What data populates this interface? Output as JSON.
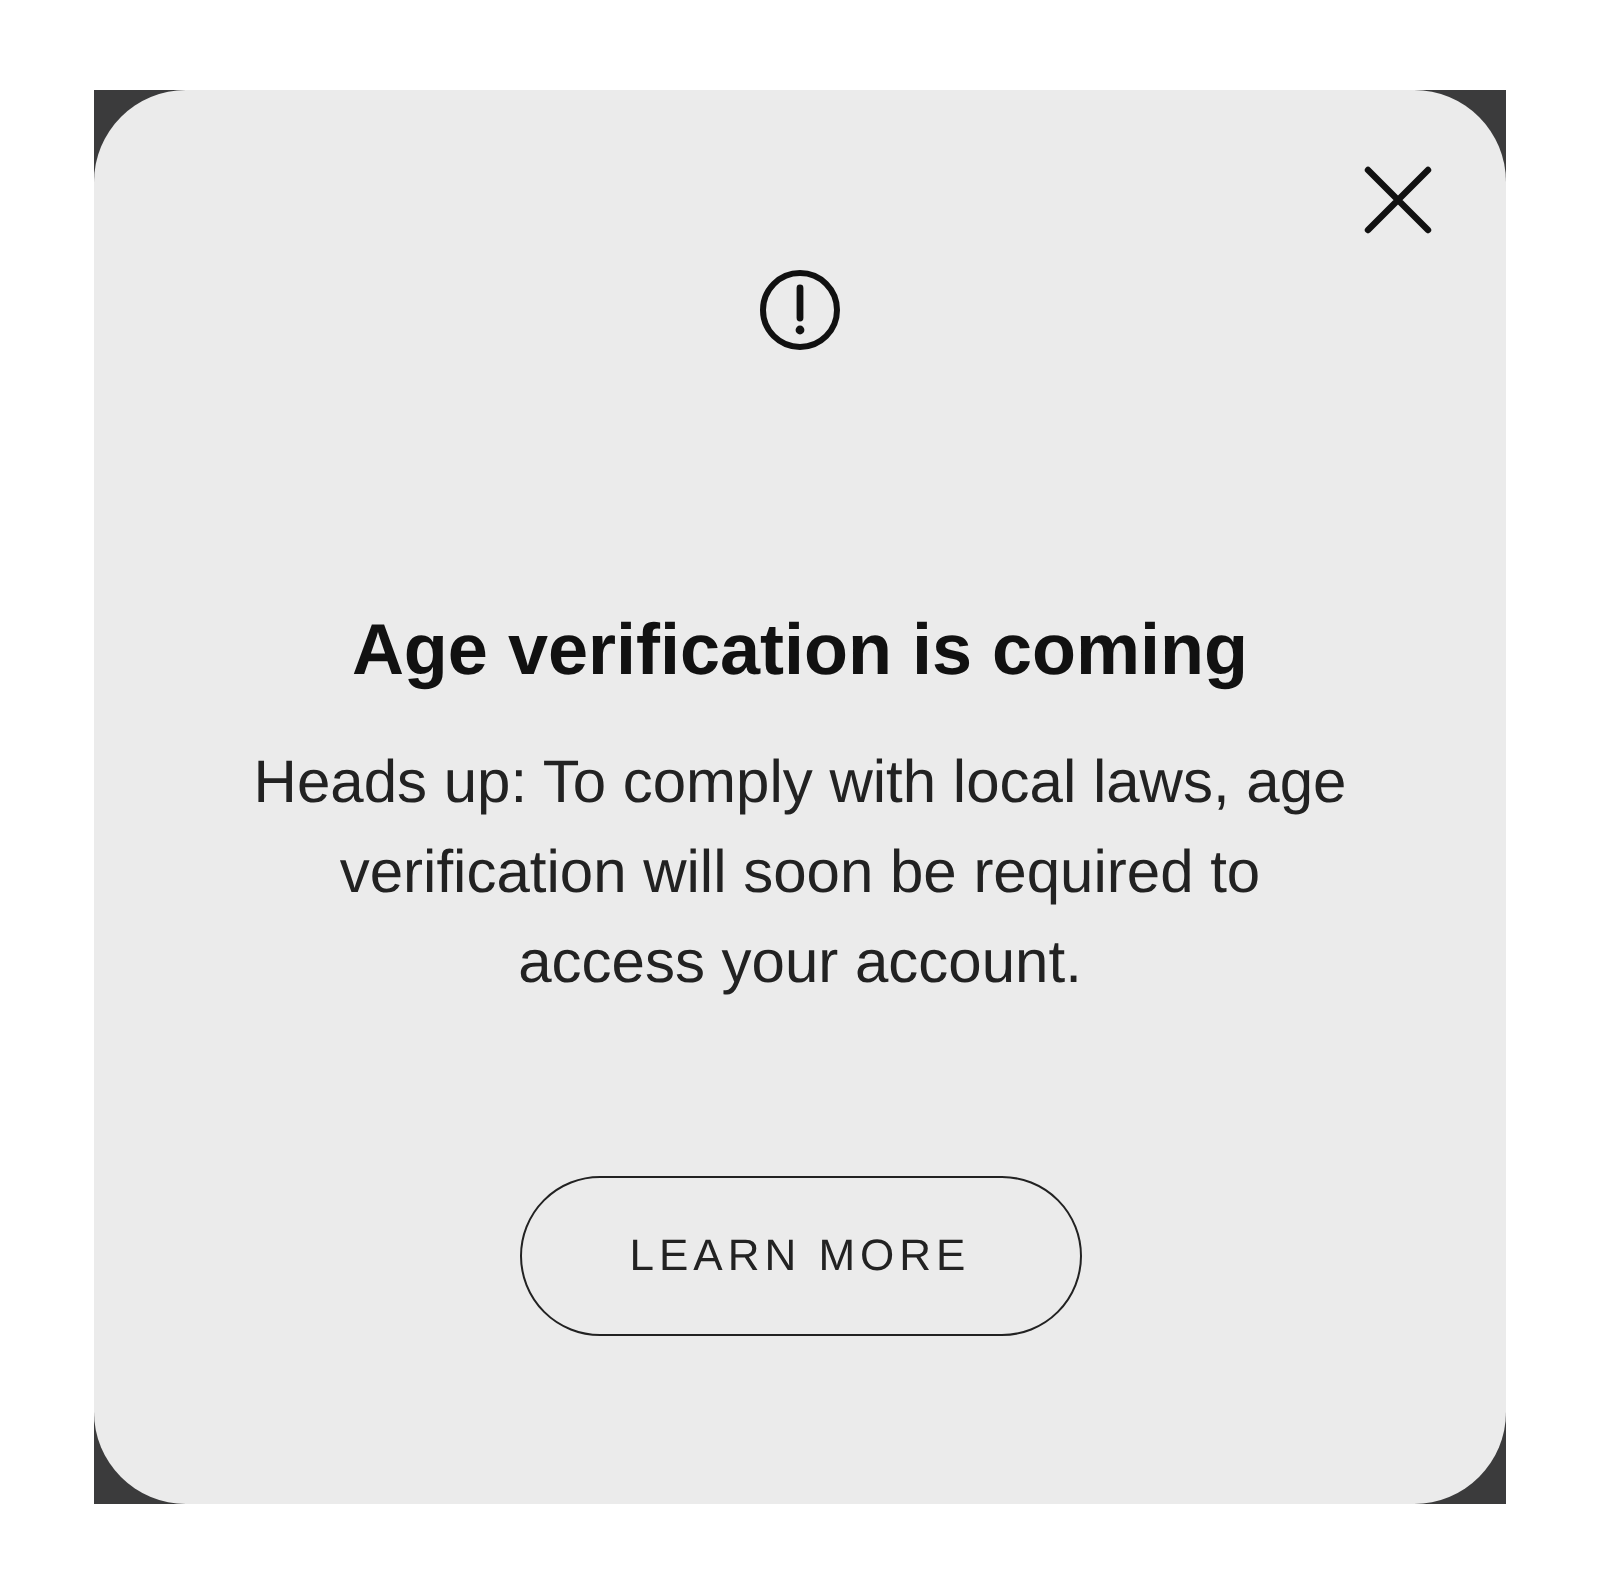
{
  "dialog": {
    "title": "Age verification is coming",
    "message": "Heads up: To comply with local laws, age verification will soon be required to access your account.",
    "button": "LEARN MORE"
  }
}
